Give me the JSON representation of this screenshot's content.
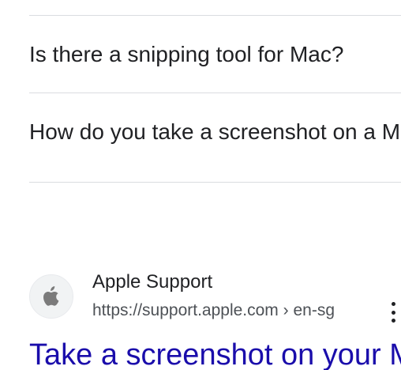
{
  "related_questions": [
    {
      "text": "Is there a snipping tool for Mac?"
    },
    {
      "text": "How do you take a screenshot on a Mac?"
    }
  ],
  "result": {
    "site_name": "Apple Support",
    "url": "https://support.apple.com › en-sg",
    "title": "Take a screenshot on your Mac",
    "favicon_icon": "apple-logo-icon",
    "menu_icon": "more-vert-icon",
    "colors": {
      "title_link": "#1a0dab",
      "url_text": "#4d5156",
      "favicon_bg": "#f1f3f4"
    }
  }
}
